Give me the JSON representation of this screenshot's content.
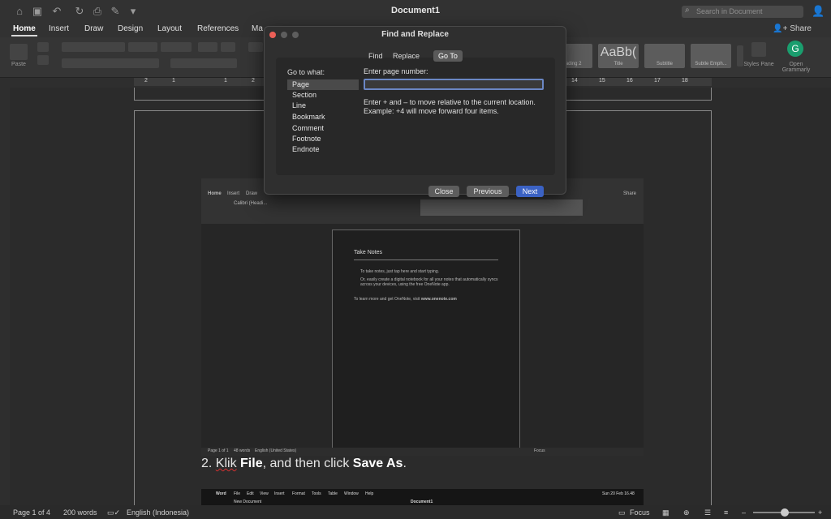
{
  "app": {
    "title": "Document1",
    "search_placeholder": "Search in Document",
    "share_label": "Share",
    "ribbon_tabs": [
      "Home",
      "Insert",
      "Draw",
      "Design",
      "Layout",
      "References",
      "Ma"
    ],
    "ribbon_labels": {
      "paste": "Paste",
      "styles_pane": "Styles Pane",
      "grammarly": "Open Grammarly",
      "style_heading2": "eading 2",
      "style_title": "Title",
      "style_subtitle": "Subtitle",
      "style_subtle_emph": "Subtle Emph...",
      "style_preview_big": "AaBb("
    },
    "ruler_numbers": [
      "2",
      "1",
      "1",
      "2",
      "14",
      "15",
      "16",
      "17",
      "18"
    ]
  },
  "dialog": {
    "title": "Find and Replace",
    "tabs": [
      "Find",
      "Replace",
      "Go To"
    ],
    "active_tab": "Go To",
    "goto_label": "Go to what:",
    "goto_items": [
      "Page",
      "Section",
      "Line",
      "Bookmark",
      "Comment",
      "Footnote",
      "Endnote"
    ],
    "selected_item": "Page",
    "page_label": "Enter page number:",
    "page_value": "",
    "hint": "Enter + and – to move relative to the current location. Example: +4 will move forward four items.",
    "buttons": {
      "close": "Close",
      "previous": "Previous",
      "next": "Next"
    }
  },
  "embedded": {
    "tabs": [
      "Home",
      "Insert",
      "Draw"
    ],
    "font": "Calibri (Headi...",
    "heading": "Take Notes",
    "bullets": [
      "To take notes, just tap here and start typing.",
      "Or, easily create a digital notebook for all your notes that automatically syncs across your devices, using the free OneNote app."
    ],
    "footer_text": "To learn more and get OneNote, visit",
    "footer_link": "www.onenote.com",
    "status": {
      "page": "Page 1 of 1",
      "words": "48 words",
      "lang": "English (United States)",
      "focus": "Focus"
    },
    "share": "Share"
  },
  "caption": {
    "prefix": "2.",
    "klik": "Klik",
    "file": "File",
    "middle": ", and then click",
    "save_as": "Save As",
    "end": "."
  },
  "embedded2": {
    "menus": [
      "Word",
      "File",
      "Edit",
      "View",
      "Insert",
      "Format",
      "Tools",
      "Table",
      "Window",
      "Help"
    ],
    "clock": "Sun 20 Feb  16.48",
    "title": "Document1",
    "new_doc": "New Document"
  },
  "statusbar": {
    "page": "Page 1 of 4",
    "words": "200 words",
    "language": "English (Indonesia)",
    "focus": "Focus"
  }
}
